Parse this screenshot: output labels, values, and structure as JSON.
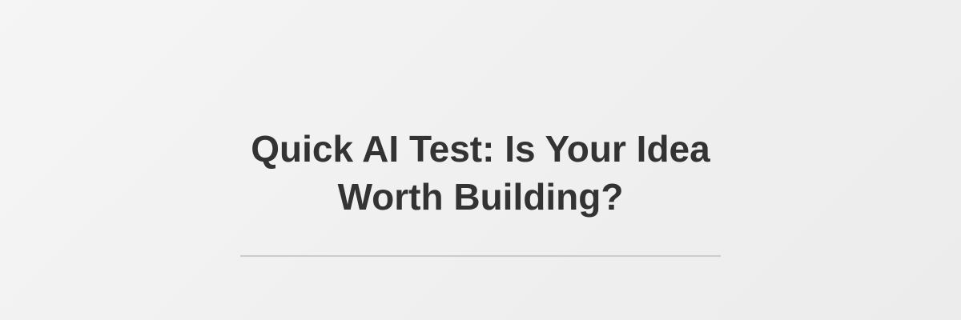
{
  "banner": {
    "title_line_1": "Quick AI Test: Is Your Idea",
    "title_line_2": "Worth Building?"
  },
  "colors": {
    "background": "#f0f0f0",
    "title_text": "#333333",
    "divider": "#cccccc"
  }
}
